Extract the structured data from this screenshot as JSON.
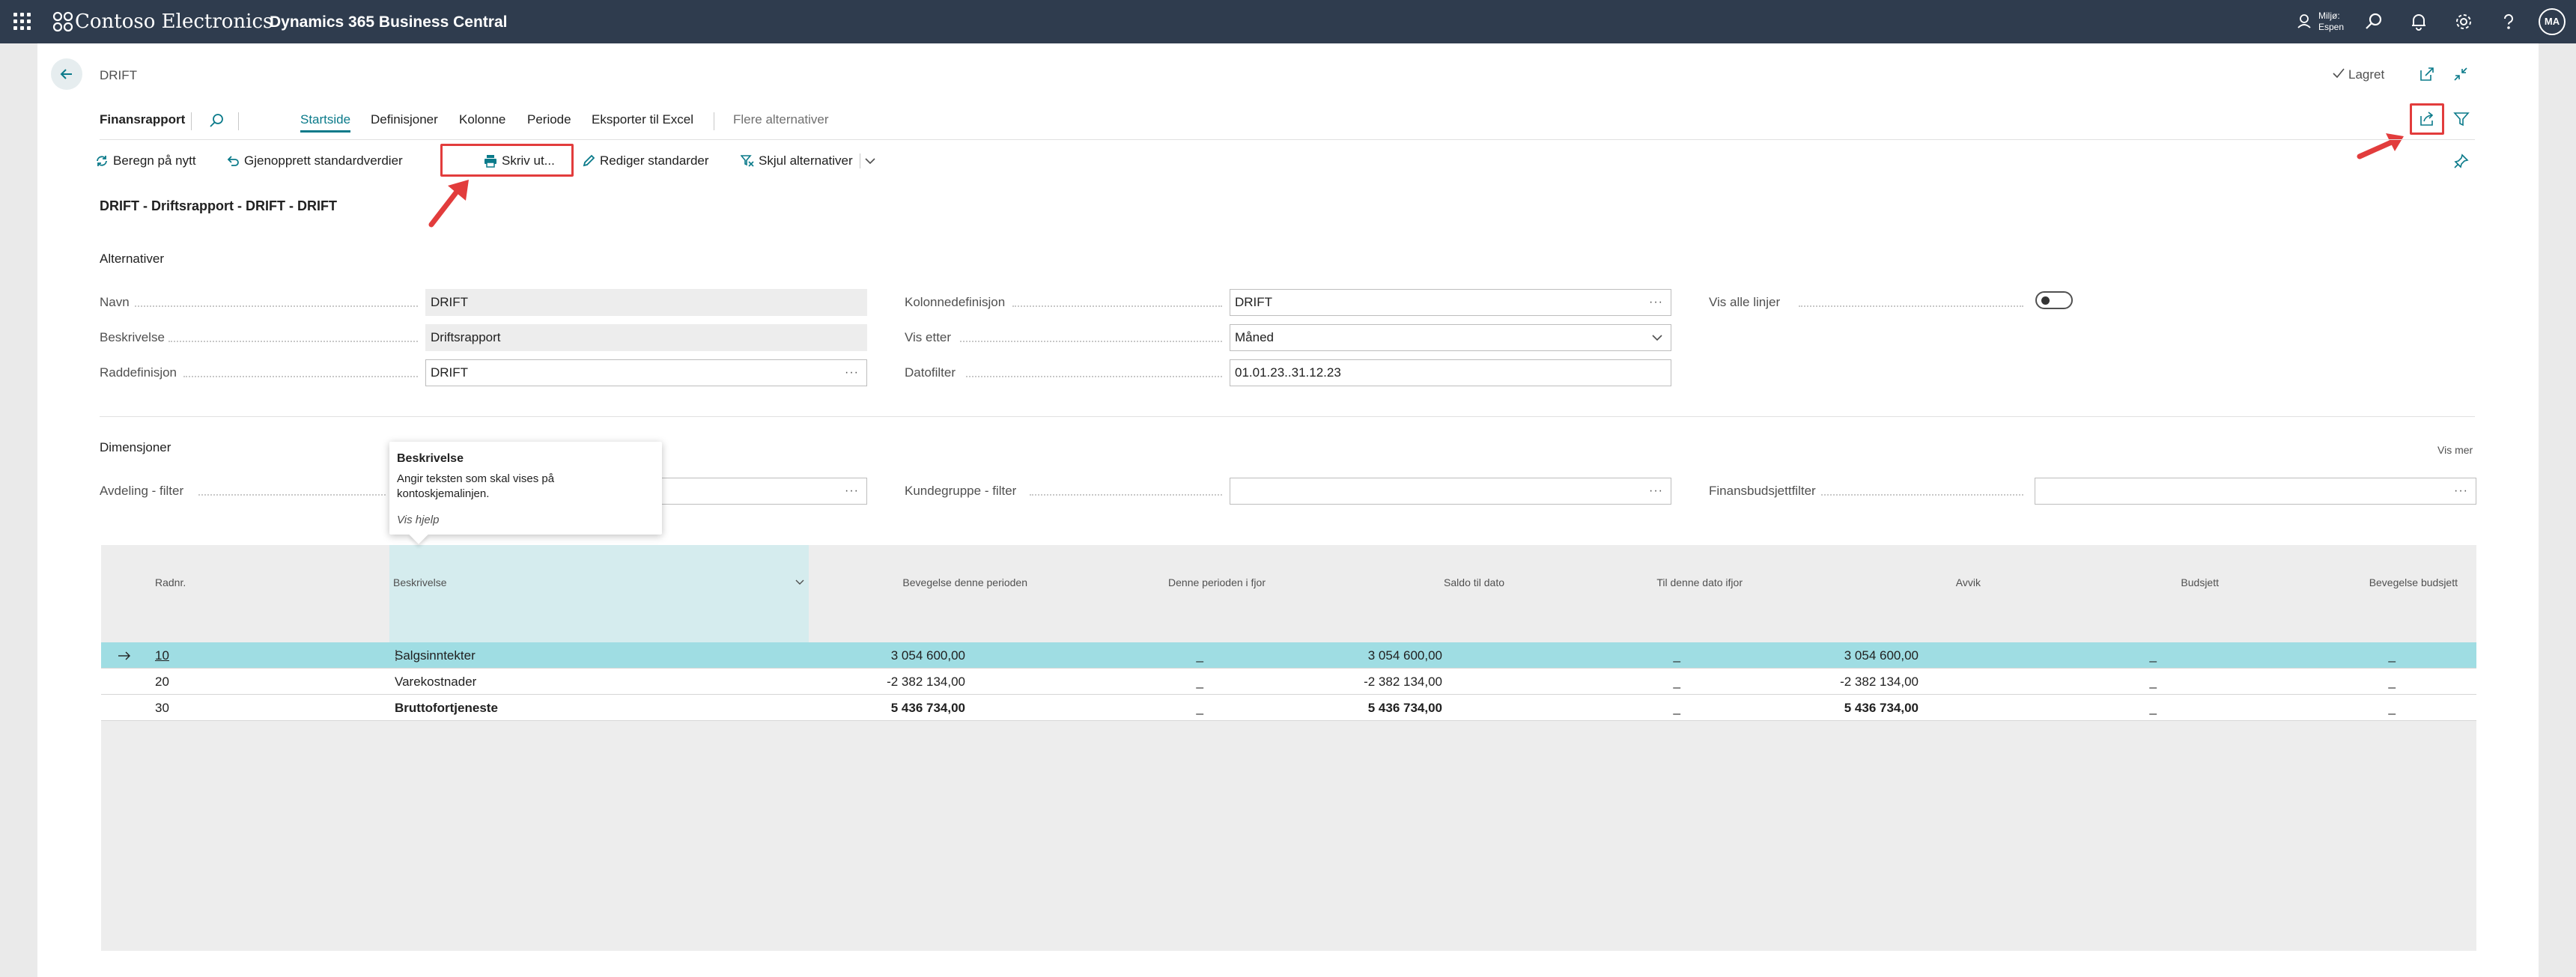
{
  "topbar": {
    "company": "Contoso Electronics",
    "product": "Dynamics 365 Business Central",
    "env_line1": "Miljø:",
    "env_line2": "Espen",
    "avatar_initials": "MA"
  },
  "header": {
    "breadcrumb": "DRIFT",
    "saved": "Lagret"
  },
  "tabs": {
    "page_label": "Finansrapport",
    "items": [
      "Startside",
      "Definisjoner",
      "Kolonne",
      "Periode",
      "Eksporter til Excel"
    ],
    "more": "Flere alternativer"
  },
  "actions": {
    "recalc": "Beregn på nytt",
    "restore": "Gjenopprett standardverdier",
    "print": "Skriv ut...",
    "edit_defaults": "Rediger standarder",
    "hide_options": "Skjul alternativer"
  },
  "doc_title": "DRIFT - Driftsrapport - DRIFT - DRIFT",
  "options": {
    "title": "Alternativer",
    "name_label": "Navn",
    "name_value": "DRIFT",
    "desc_label": "Beskrivelse",
    "desc_value": "Driftsrapport",
    "rowdef_label": "Raddefinisjon",
    "rowdef_value": "DRIFT",
    "coldef_label": "Kolonnedefinisjon",
    "coldef_value": "DRIFT",
    "viewby_label": "Vis etter",
    "viewby_value": "Måned",
    "datefilter_label": "Datofilter",
    "datefilter_value": "01.01.23..31.12.23",
    "showall_label": "Vis alle linjer",
    "showall_on": false
  },
  "dimensions": {
    "title": "Dimensjoner",
    "show_more": "Vis mer",
    "dept_label": "Avdeling  - filter",
    "dept_value": "",
    "custgroup_label": "Kundegruppe  - filter",
    "custgroup_value": "",
    "budget_label": "Finansbudsjettfilter",
    "budget_value": ""
  },
  "tooltip": {
    "title": "Beskrivelse",
    "body": "Angir teksten som skal vises på kontoskjemalinjen.",
    "link": "Vis hjelp"
  },
  "grid": {
    "headers": [
      "Radnr.",
      "Beskrivelse",
      "Bevegelse denne perioden",
      "Denne perioden i fjor",
      "Saldo til dato",
      "Til denne dato ifjor",
      "Avvik",
      "Budsjett",
      "Bevegelse budsjett"
    ],
    "rows": [
      {
        "no": "10",
        "desc": "Salgsinntekter",
        "mov": "3 054 600,00",
        "prev": "_",
        "bal": "3 054 600,00",
        "balprev": "_",
        "dev": "3 054 600,00",
        "budget": "_",
        "budmov": "_"
      },
      {
        "no": "20",
        "desc": "Varekostnader",
        "mov": "-2 382 134,00",
        "prev": "_",
        "bal": "-2 382 134,00",
        "balprev": "_",
        "dev": "-2 382 134,00",
        "budget": "_",
        "budmov": "_"
      },
      {
        "no": "30",
        "desc": "Bruttofortjeneste",
        "mov": "5 436 734,00",
        "prev": "_",
        "bal": "5 436 734,00",
        "balprev": "_",
        "dev": "5 436 734,00",
        "budget": "_",
        "budmov": "_"
      }
    ]
  },
  "colors": {
    "topbar": "#2f3c4e",
    "accent": "#0a7a8a",
    "selected_row": "#9fdde3",
    "highlight_box": "#e23c3c"
  }
}
